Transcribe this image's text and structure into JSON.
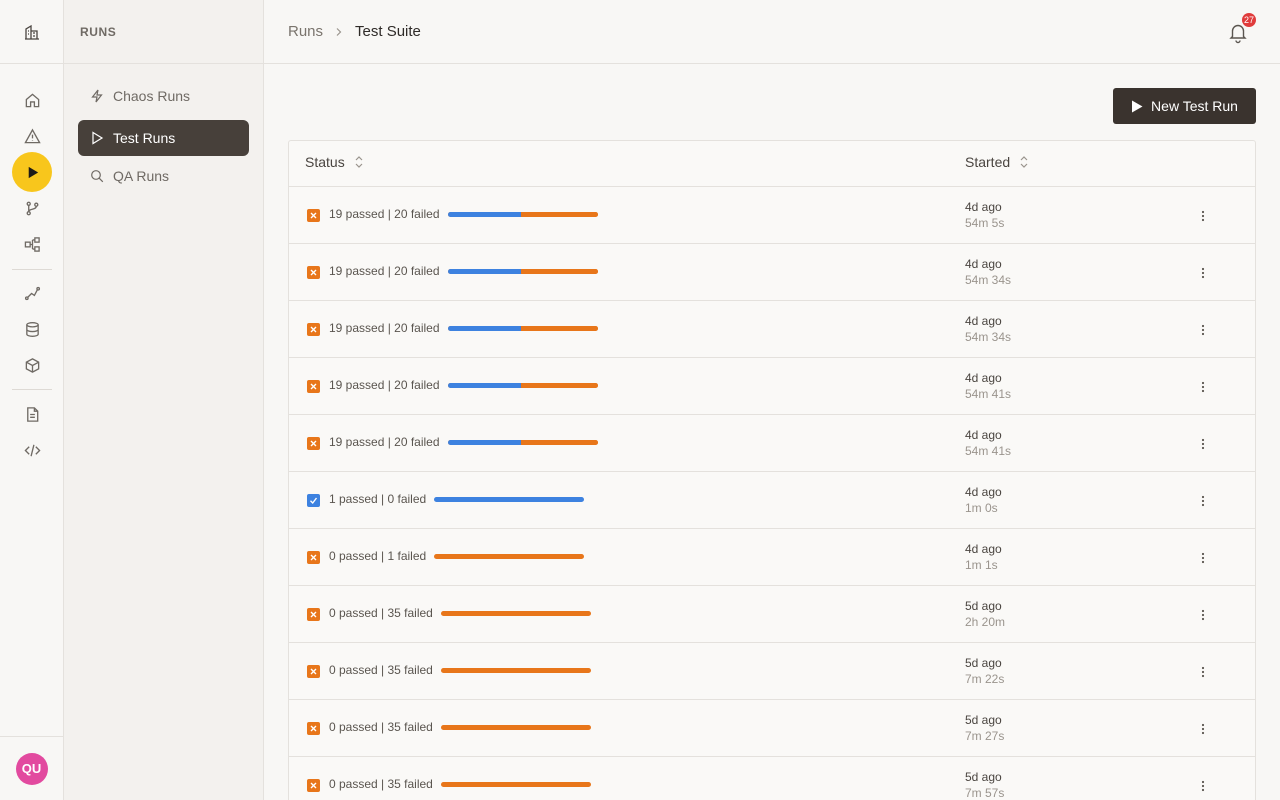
{
  "sidebar": {
    "avatar_initials": "QU"
  },
  "subnav": {
    "heading": "RUNS",
    "items": [
      {
        "label": "Chaos Runs",
        "icon": "bolt-icon"
      },
      {
        "label": "Test Runs",
        "icon": "play-outline-icon",
        "active": true
      },
      {
        "label": "QA Runs",
        "icon": "search-icon"
      }
    ]
  },
  "breadcrumb": {
    "parent": "Runs",
    "current": "Test Suite"
  },
  "notifications": {
    "count": "27"
  },
  "toolbar": {
    "new_run_label": "New Test Run"
  },
  "table": {
    "columns": {
      "status": "Status",
      "started": "Started"
    },
    "rows": [
      {
        "status": "fail",
        "summary": "19 passed | 20 failed",
        "passed": 19,
        "failed": 20,
        "ago": "4d ago",
        "duration": "54m 5s"
      },
      {
        "status": "fail",
        "summary": "19 passed | 20 failed",
        "passed": 19,
        "failed": 20,
        "ago": "4d ago",
        "duration": "54m 34s"
      },
      {
        "status": "fail",
        "summary": "19 passed | 20 failed",
        "passed": 19,
        "failed": 20,
        "ago": "4d ago",
        "duration": "54m 34s"
      },
      {
        "status": "fail",
        "summary": "19 passed | 20 failed",
        "passed": 19,
        "failed": 20,
        "ago": "4d ago",
        "duration": "54m 41s"
      },
      {
        "status": "fail",
        "summary": "19 passed | 20 failed",
        "passed": 19,
        "failed": 20,
        "ago": "4d ago",
        "duration": "54m 41s"
      },
      {
        "status": "pass",
        "summary": "1 passed | 0 failed",
        "passed": 1,
        "failed": 0,
        "ago": "4d ago",
        "duration": "1m 0s"
      },
      {
        "status": "fail",
        "summary": "0 passed | 1 failed",
        "passed": 0,
        "failed": 1,
        "ago": "4d ago",
        "duration": "1m 1s"
      },
      {
        "status": "fail",
        "summary": "0 passed | 35 failed",
        "passed": 0,
        "failed": 35,
        "ago": "5d ago",
        "duration": "2h 20m"
      },
      {
        "status": "fail",
        "summary": "0 passed | 35 failed",
        "passed": 0,
        "failed": 35,
        "ago": "5d ago",
        "duration": "7m 22s"
      },
      {
        "status": "fail",
        "summary": "0 passed | 35 failed",
        "passed": 0,
        "failed": 35,
        "ago": "5d ago",
        "duration": "7m 27s"
      },
      {
        "status": "fail",
        "summary": "0 passed | 35 failed",
        "passed": 0,
        "failed": 35,
        "ago": "5d ago",
        "duration": "7m 57s"
      }
    ]
  },
  "colors": {
    "accent": "#f8c61c",
    "pass": "#3d82e0",
    "fail": "#e8761a",
    "primary_button": "#3a332e",
    "avatar": "#e24a9f",
    "badge": "#e03b3b"
  }
}
